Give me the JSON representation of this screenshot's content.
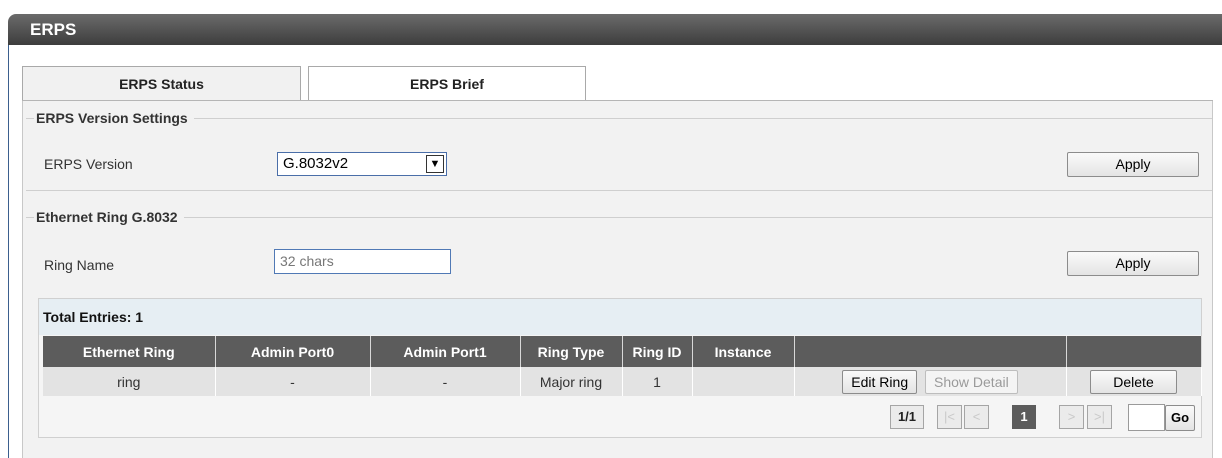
{
  "page": {
    "title": "ERPS"
  },
  "tabs": [
    {
      "label": "ERPS Status",
      "active": true
    },
    {
      "label": "ERPS Brief",
      "active": false
    }
  ],
  "version_settings": {
    "legend": "ERPS Version Settings",
    "label": "ERPS Version",
    "selected": "G.8032v2",
    "apply_label": "Apply"
  },
  "ring": {
    "legend": "Ethernet Ring G.8032",
    "label": "Ring Name",
    "placeholder": "32 chars",
    "apply_label": "Apply"
  },
  "table": {
    "total_label": "Total Entries: 1",
    "columns": [
      "Ethernet Ring",
      "Admin Port0",
      "Admin Port1",
      "Ring Type",
      "Ring ID",
      "Instance",
      "",
      ""
    ],
    "rows": [
      {
        "ethernet_ring": "ring",
        "admin_port0": "-",
        "admin_port1": "-",
        "ring_type": "Major ring",
        "ring_id": "1",
        "instance": "",
        "edit_label": "Edit Ring",
        "detail_label": "Show Detail",
        "delete_label": "Delete"
      }
    ]
  },
  "pagination": {
    "total": "1/1",
    "first": "|<",
    "prev": "<",
    "current": "1",
    "next": ">",
    "last": ">|",
    "go_label": "Go"
  },
  "colors": {
    "header_bg": "#5c5c5c",
    "title_bar": "#4a4a4a",
    "entries_bar": "#e6eef3"
  }
}
